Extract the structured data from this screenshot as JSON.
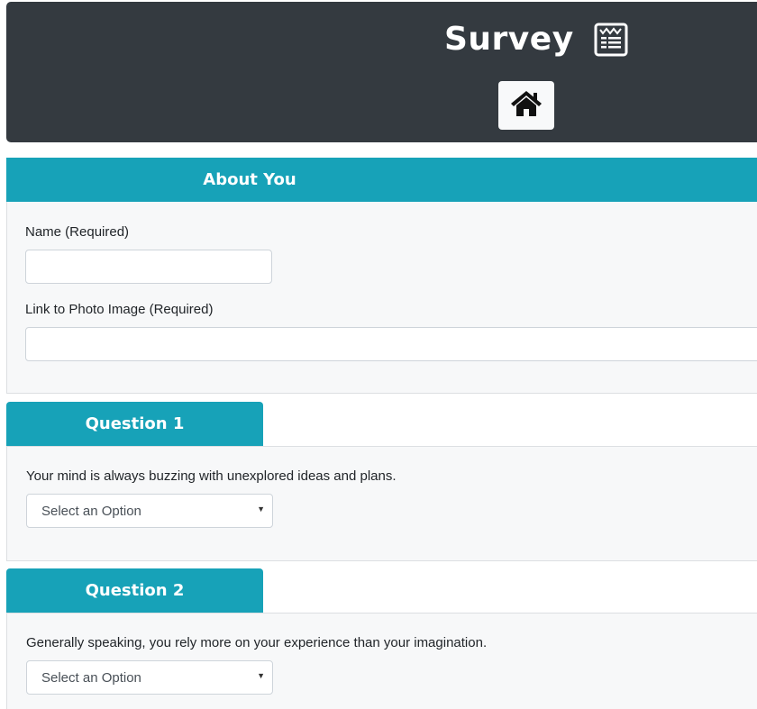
{
  "header": {
    "title": "Survey",
    "title_icon": "survey-list-icon",
    "home_icon": "home-icon"
  },
  "about": {
    "heading": "About You",
    "name_label": "Name (Required)",
    "name_value": "",
    "photo_label": "Link to Photo Image (Required)",
    "photo_value": ""
  },
  "questions": [
    {
      "heading": "Question 1",
      "text": "Your mind is always buzzing with unexplored ideas and plans.",
      "selected": "Select an Option"
    },
    {
      "heading": "Question 2",
      "text": "Generally speaking, you rely more on your experience than your imagination.",
      "selected": "Select an Option"
    }
  ],
  "colors": {
    "header_bg": "#343a40",
    "accent": "#17a2b8",
    "panel_bg": "#f7f8f9"
  }
}
